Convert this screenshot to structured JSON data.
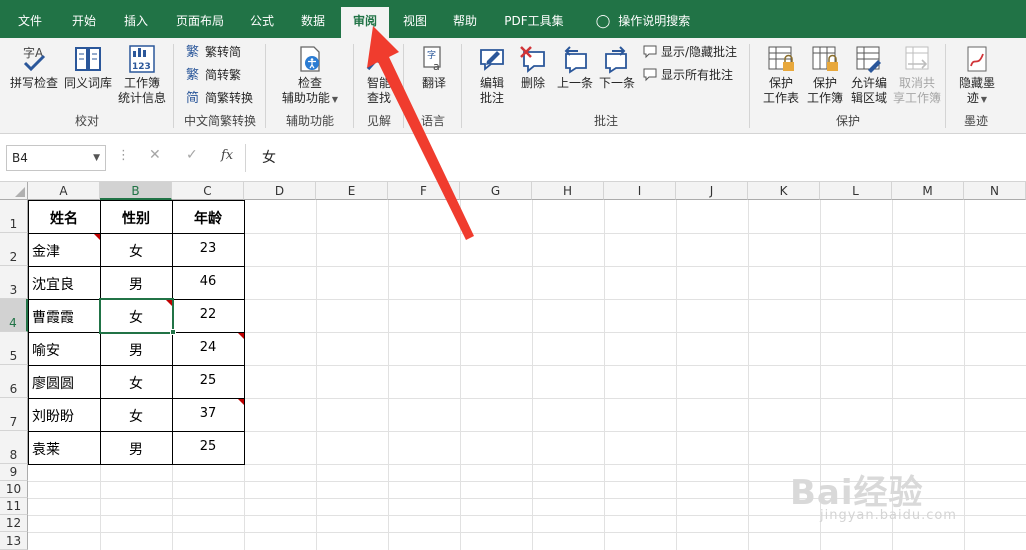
{
  "tabs": [
    {
      "label": "文件"
    },
    {
      "label": "开始"
    },
    {
      "label": "插入"
    },
    {
      "label": "页面布局"
    },
    {
      "label": "公式"
    },
    {
      "label": "数据"
    },
    {
      "label": "审阅"
    },
    {
      "label": "视图"
    },
    {
      "label": "帮助"
    },
    {
      "label": "PDF工具集"
    },
    {
      "label": "操作说明搜索"
    }
  ],
  "active_tab": "审阅",
  "ribbon": {
    "proofing": {
      "spell": "拼写检查",
      "thesaurus": "同义词库",
      "stats_1": "工作簿",
      "stats_2": "统计信息",
      "label": "校对"
    },
    "chinese": {
      "to_simplified": "繁转简",
      "to_traditional": "简转繁",
      "convert": "简繁转换",
      "label": "中文简繁转换"
    },
    "assist": {
      "check_1": "检查",
      "check_2": "辅助功能",
      "label": "辅助功能"
    },
    "insights": {
      "smart_1": "智能",
      "smart_2": "查找",
      "label": "见解"
    },
    "language": {
      "translate": "翻译",
      "label": "语言"
    },
    "comments": {
      "edit_1": "编辑",
      "edit_2": "批注",
      "delete": "删除",
      "prev": "上一条",
      "next": "下一条",
      "show_hide": "显示/隐藏批注",
      "show_all": "显示所有批注",
      "label": "批注"
    },
    "protect": {
      "sheet_1": "保护",
      "sheet_2": "工作表",
      "book_1": "保护",
      "book_2": "工作簿",
      "allow_1": "允许编",
      "allow_2": "辑区域",
      "unshare_1": "取消共",
      "unshare_2": "享工作簿",
      "label": "保护"
    },
    "ink": {
      "hide_1": "隐藏墨",
      "hide_2": "迹",
      "label": "墨迹"
    }
  },
  "formula_bar": {
    "name_box": "B4",
    "value": "女"
  },
  "columns": [
    "A",
    "B",
    "C",
    "D",
    "E",
    "F",
    "G",
    "H",
    "I",
    "J",
    "K",
    "L",
    "M",
    "N"
  ],
  "rows": [
    "1",
    "2",
    "3",
    "4",
    "5",
    "6",
    "7",
    "8",
    "9",
    "10",
    "11",
    "12",
    "13"
  ],
  "table": {
    "headers": [
      "姓名",
      "性别",
      "年龄"
    ],
    "rows": [
      [
        "金津",
        "女",
        "23"
      ],
      [
        "沈宜良",
        "男",
        "46"
      ],
      [
        "曹霞霞",
        "女",
        "22"
      ],
      [
        "喻安",
        "男",
        "24"
      ],
      [
        "廖圆圆",
        "女",
        "25"
      ],
      [
        "刘盼盼",
        "女",
        "37"
      ],
      [
        "袁莱",
        "男",
        "25"
      ]
    ]
  },
  "colors": {
    "accent": "#217346",
    "comment_marker": "#c00000",
    "arrow": "#f03c2e"
  },
  "watermark": {
    "brand": "Bai经验",
    "url": "jingyan.baidu.com"
  }
}
